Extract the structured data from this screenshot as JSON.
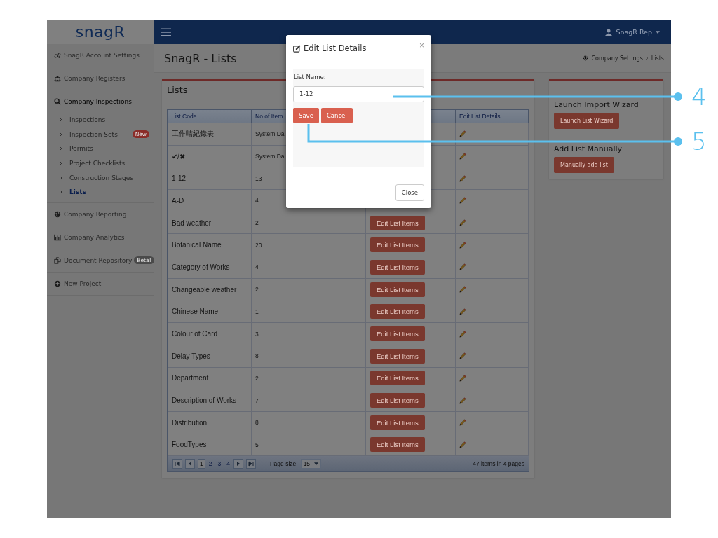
{
  "logo": "snagR",
  "topbar": {
    "user": "SnagR Rep"
  },
  "sidebar": {
    "items": [
      {
        "label": "SnagR Account Settings"
      },
      {
        "label": "Company Registers"
      },
      {
        "label": "Company Inspections",
        "expanded": true,
        "children": [
          {
            "label": "Inspections",
            "selected": false
          },
          {
            "label": "Inspection Sets",
            "selected": false,
            "badge": {
              "text": "New",
              "color": "#8a2c28"
            }
          },
          {
            "label": "Permits",
            "selected": false
          },
          {
            "label": "Project Checklists",
            "selected": false
          },
          {
            "label": "Construction Stages",
            "selected": false
          },
          {
            "label": "Lists",
            "selected": true
          }
        ]
      },
      {
        "label": "Company Reporting"
      },
      {
        "label": "Company Analytics"
      },
      {
        "label": "Document Repository",
        "badge": {
          "text": "Beta!",
          "color": "#4a4a4a"
        }
      },
      {
        "label": "New Project"
      }
    ]
  },
  "page": {
    "title": "SnagR - Lists",
    "breadcrumb": [
      "Company Settings",
      "Lists"
    ]
  },
  "lists_panel": {
    "title": "Lists",
    "table": {
      "columns": [
        {
          "kind": "text",
          "label": "List Code"
        },
        {
          "kind": "text",
          "label": "No of Item"
        },
        {
          "kind": "blank"
        },
        {
          "kind": "text",
          "label": "Edit List Details"
        }
      ],
      "rows": [
        {
          "code": "工作咭紀錄表",
          "count": "System.Da"
        },
        {
          "code": "✔/✖",
          "count": "System.Da"
        },
        {
          "code": "1-12",
          "count": "13"
        },
        {
          "code": "A-D",
          "count": "4"
        },
        {
          "code": "Bad weather",
          "count": "2",
          "action": "Edit List Items"
        },
        {
          "code": "Botanical Name",
          "count": "20",
          "action": "Edit List Items"
        },
        {
          "code": "Category of Works",
          "count": "4",
          "action": "Edit List Items"
        },
        {
          "code": "Changeable weather",
          "count": "2",
          "action": "Edit List Items"
        },
        {
          "code": "Chinese Name",
          "count": "1",
          "action": "Edit List Items"
        },
        {
          "code": "Colour of Card",
          "count": "3",
          "action": "Edit List Items"
        },
        {
          "code": "Delay Types",
          "count": "8",
          "action": "Edit List Items"
        },
        {
          "code": "Department",
          "count": "2",
          "action": "Edit List Items"
        },
        {
          "code": "Description of Works",
          "count": "7",
          "action": "Edit List Items"
        },
        {
          "code": "Distribution",
          "count": "8",
          "action": "Edit List Items"
        },
        {
          "code": "FoodTypes",
          "count": "5",
          "action": "Edit List Items"
        }
      ],
      "pager": {
        "pages": [
          {
            "label": "1",
            "selected": true
          },
          {
            "label": "2",
            "selected": false
          },
          {
            "label": "3",
            "selected": false
          },
          {
            "label": "4",
            "selected": false
          }
        ],
        "page_size_label": "Page size:",
        "page_size": "15",
        "summary": "47 items in 4 pages"
      }
    }
  },
  "side_panel": {
    "sections": [
      {
        "heading": "Launch Import Wizard",
        "button": "Launch List Wizard"
      },
      {
        "heading": "Add List Manually",
        "button": "Manually add list"
      }
    ]
  },
  "modal": {
    "title": "Edit List Details",
    "close": "×",
    "field_label": "List Name:",
    "value": "1-12",
    "buttons": [
      "Save",
      "Cancel"
    ],
    "footer_button": "Close"
  },
  "callouts": [
    {
      "label": "4"
    },
    {
      "label": "5"
    }
  ]
}
